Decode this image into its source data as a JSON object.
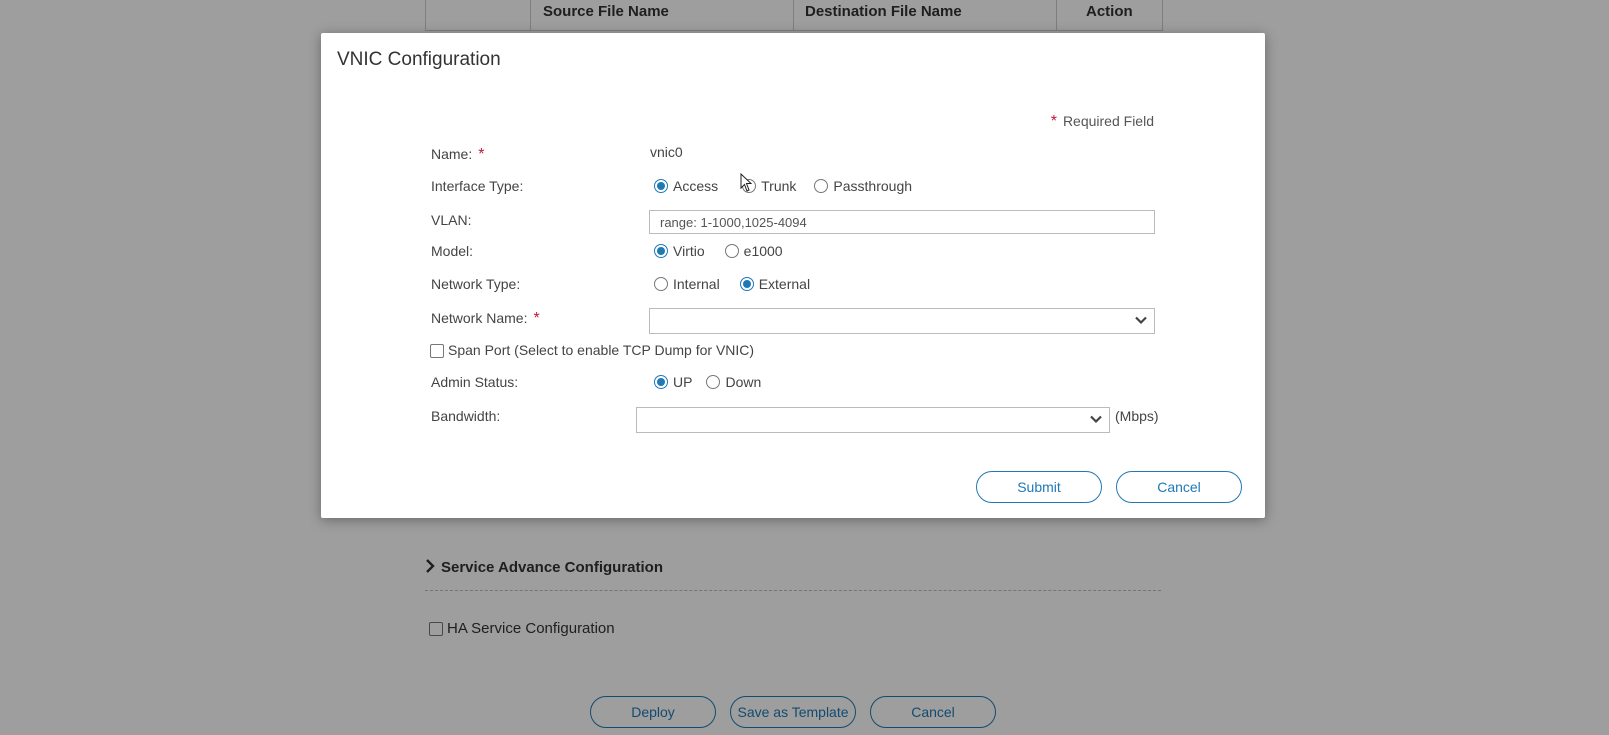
{
  "background": {
    "table_headers": [
      "Source File Name",
      "Destination File Name",
      "Action"
    ],
    "service_advance_label": "Service Advance Configuration",
    "ha_service_label": "HA Service Configuration",
    "buttons": {
      "deploy": "Deploy",
      "save_template": "Save as Template",
      "cancel": "Cancel"
    }
  },
  "modal": {
    "title": "VNIC Configuration",
    "required_note": "Required Field",
    "required_star": "*",
    "name": {
      "label": "Name:",
      "value": "vnic0"
    },
    "interface_type": {
      "label": "Interface Type:",
      "options": [
        "Access",
        "Trunk",
        "Passthrough"
      ],
      "selected": "Access"
    },
    "vlan": {
      "label": "VLAN:",
      "placeholder": "range: 1-1000,1025-4094",
      "value": ""
    },
    "model": {
      "label": "Model:",
      "options": [
        "Virtio",
        "e1000"
      ],
      "selected": "Virtio"
    },
    "network_type": {
      "label": "Network Type:",
      "options": [
        "Internal",
        "External"
      ],
      "selected": "External"
    },
    "network_name": {
      "label": "Network Name:",
      "value": ""
    },
    "span_port": {
      "label": "Span Port (Select to enable TCP Dump for VNIC)",
      "checked": false
    },
    "admin_status": {
      "label": "Admin Status:",
      "options": [
        "UP",
        "Down"
      ],
      "selected": "UP"
    },
    "bandwidth": {
      "label": "Bandwidth:",
      "value": "",
      "unit": "(Mbps)"
    },
    "buttons": {
      "submit": "Submit",
      "cancel": "Cancel"
    }
  },
  "colors": {
    "accent": "#1f79b5",
    "required": "#c0193c"
  }
}
